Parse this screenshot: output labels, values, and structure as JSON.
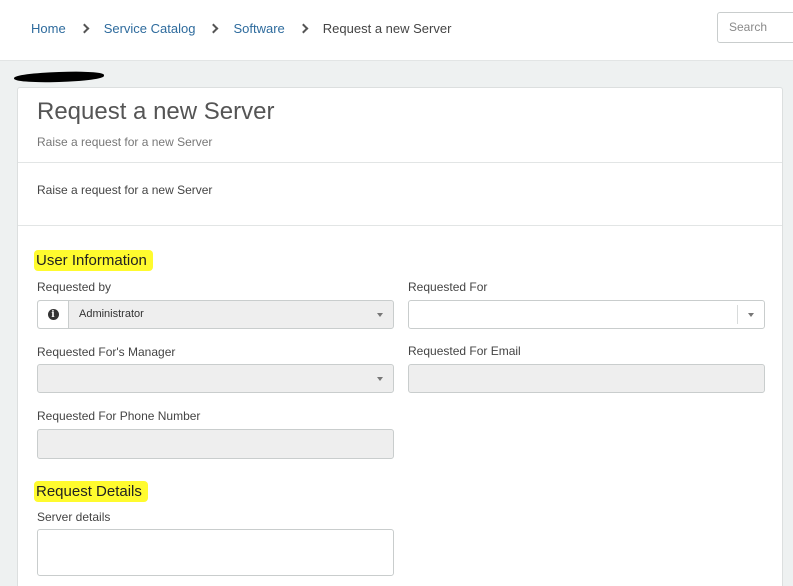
{
  "breadcrumb": {
    "items": [
      "Home",
      "Service Catalog",
      "Software"
    ],
    "current": "Request a new Server"
  },
  "search": {
    "placeholder": "Search"
  },
  "card": {
    "title": "Request a new Server",
    "subtitle": "Raise a request for a new Server",
    "description": "Raise a request for a new Server"
  },
  "sections": {
    "user_information": "User Information",
    "request_details": "Request Details"
  },
  "fields": {
    "requested_by": {
      "label": "Requested by",
      "value": "Administrator"
    },
    "requested_for": {
      "label": "Requested For",
      "value": ""
    },
    "requested_for_manager": {
      "label": "Requested For's Manager",
      "value": ""
    },
    "requested_for_email": {
      "label": "Requested For Email",
      "value": ""
    },
    "requested_for_phone": {
      "label": "Requested For Phone Number",
      "value": ""
    },
    "server_details": {
      "label": "Server details",
      "value": ""
    }
  },
  "colors": {
    "link": "#2e6b9d",
    "highlight": "#fffb2e",
    "readonly_bg": "#eeeeee"
  }
}
